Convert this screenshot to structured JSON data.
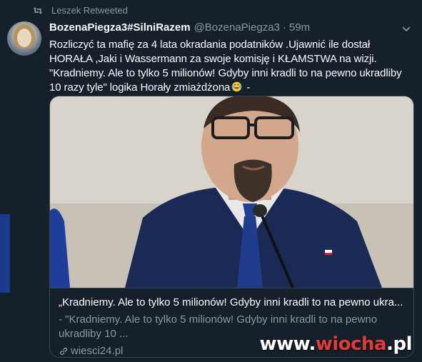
{
  "retweet": {
    "label": "Leszek Retweeted"
  },
  "author": {
    "display_name": "BozenaPiegza3#SilniRazem",
    "handle": "@BozenaPiegza3",
    "separator": "·",
    "time": "59m"
  },
  "tweet": {
    "lines": [
      "Rozliczyć ta mafię za 4 lata okradania podatników .Ujawnić ile dostał",
      "HORAŁA ,Jaki i Wassermann za swoje komisję i KŁAMSTWA na wizji.",
      "\"Kradniemy. Ale to tylko 5 milionów! Gdyby inni kradli to na pewno ukradliby",
      "10 razy tyle\" logika Horały zmiażdżona",
      " -"
    ],
    "emoji": "laughing-tears-emoji"
  },
  "card": {
    "title": "„Kradniemy. Ale to tylko 5 milionów! Gdyby inni kradli to na pewno ukra...",
    "description_line1": "- \"Kradniemy. Ale to tylko 5 milionów! Gdyby inni kradli to na pewno",
    "description_line2": "ukradliby 10 ...",
    "domain": "wiesci24.pl"
  },
  "watermark": {
    "prefix": "www.",
    "highlight": "wiocha",
    "suffix": ".pl"
  },
  "colors": {
    "background": "#15202b",
    "secondary_text": "#8899a6",
    "border": "#38444d",
    "watermark_accent": "#e23a3a"
  }
}
